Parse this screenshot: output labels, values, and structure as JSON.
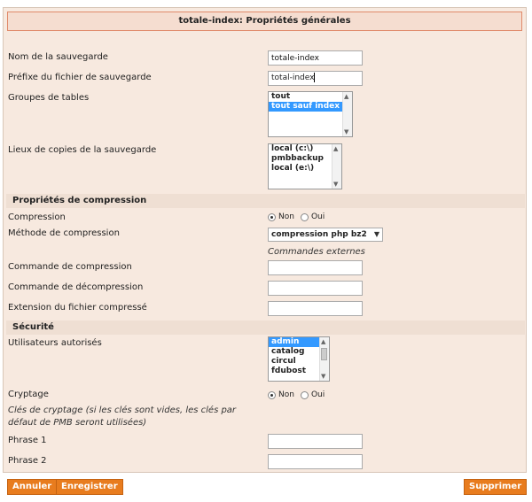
{
  "panel": {
    "title": "totale-index: Propriétés générales"
  },
  "fields": {
    "backup_name": {
      "label": "Nom de la sauvegarde",
      "value": "totale-index"
    },
    "file_prefix": {
      "label": "Préfixe du fichier de sauvegarde",
      "value": "total-index"
    },
    "table_groups": {
      "label": "Groupes de tables",
      "options": [
        "tout",
        "tout sauf index"
      ],
      "selected": "tout sauf index"
    },
    "copy_locations": {
      "label": "Lieux de copies de la sauvegarde",
      "options": [
        "local (c:\\)",
        "pmbbackup",
        "local (e:\\)"
      ]
    }
  },
  "compression": {
    "section_title": "Propriétés de compression",
    "compression_label": "Compression",
    "no_label": "Non",
    "yes_label": "Oui",
    "method_label": "Méthode de compression",
    "method_value": "compression php bz2",
    "external_commands": "Commandes externes",
    "compress_cmd_label": "Commande de compression",
    "decompress_cmd_label": "Commande de décompression",
    "extension_label": "Extension du fichier compressé"
  },
  "security": {
    "section_title": "Sécurité",
    "users_label": "Utilisateurs autorisés",
    "users": [
      "admin",
      "catalog",
      "circul",
      "fdubost"
    ],
    "selected_user": "admin",
    "crypt_label": "Cryptage",
    "no_label": "Non",
    "yes_label": "Oui",
    "keys_note_line1": "Clés de cryptage (si les clés sont vides, les clés par",
    "keys_note_line2": "défaut de PMB seront utilisées)",
    "phrase1_label": "Phrase 1",
    "phrase2_label": "Phrase 2"
  },
  "buttons": {
    "cancel": "Annuler",
    "save": "Enregistrer",
    "delete": "Supprimer"
  },
  "colors": {
    "panel_bg": "#f7e9df",
    "button_orange": "#e87c1e",
    "selection_blue": "#3399ff"
  }
}
